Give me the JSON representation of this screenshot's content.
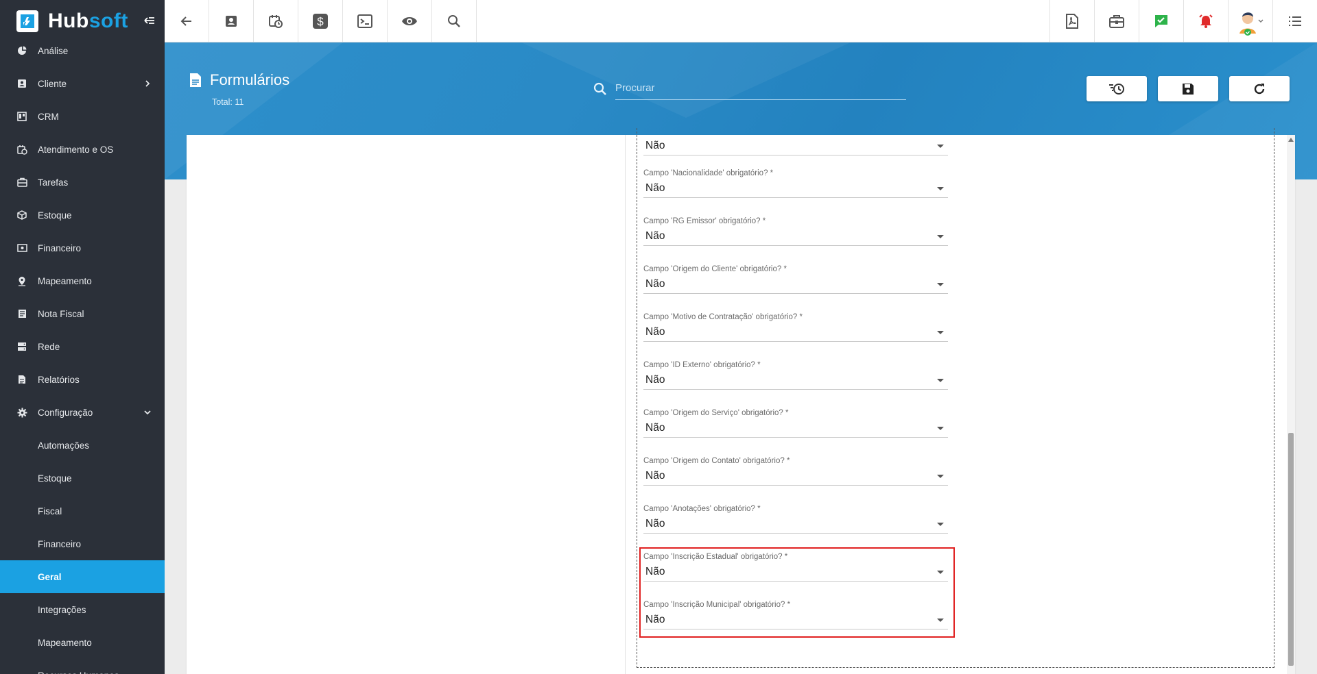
{
  "app": {
    "logo_part1": "Hub",
    "logo_part2": "soft"
  },
  "sidebar": {
    "items": [
      {
        "label": "Análise",
        "icon": "pie-chart-icon"
      },
      {
        "label": "Cliente",
        "icon": "contact-card-icon",
        "has_children": true
      },
      {
        "label": "CRM",
        "icon": "kanban-icon"
      },
      {
        "label": "Atendimento e OS",
        "icon": "calendar-clock-icon"
      },
      {
        "label": "Tarefas",
        "icon": "briefcase-icon"
      },
      {
        "label": "Estoque",
        "icon": "box-icon"
      },
      {
        "label": "Financeiro",
        "icon": "money-icon"
      },
      {
        "label": "Mapeamento",
        "icon": "map-pin-icon"
      },
      {
        "label": "Nota Fiscal",
        "icon": "invoice-icon"
      },
      {
        "label": "Rede",
        "icon": "server-icon"
      },
      {
        "label": "Relatórios",
        "icon": "report-icon"
      },
      {
        "label": "Configuração",
        "icon": "gear-icon",
        "expanded": true
      }
    ],
    "subitems": [
      {
        "label": "Automações"
      },
      {
        "label": "Estoque"
      },
      {
        "label": "Fiscal"
      },
      {
        "label": "Financeiro"
      },
      {
        "label": "Geral",
        "active": true
      },
      {
        "label": "Integrações"
      },
      {
        "label": "Mapeamento"
      },
      {
        "label": "Recursos Humanos"
      }
    ]
  },
  "topbar": {
    "left_buttons": [
      "back-arrow-icon",
      "contact-card-icon",
      "calendar-clock-icon",
      "dollar-icon",
      "terminal-icon",
      "eye-icon",
      "search-icon"
    ],
    "right_buttons": [
      "pdf-icon",
      "briefcase-icon",
      "chat-check-icon",
      "alarm-bell-icon",
      "avatar",
      "list-menu-icon"
    ]
  },
  "header": {
    "title": "Formulários",
    "subtitle": "Total: 11",
    "search_placeholder": "Procurar",
    "buttons": [
      "history-icon",
      "save-icon",
      "refresh-icon"
    ]
  },
  "form": {
    "fields": [
      {
        "label": "",
        "value": "Não"
      },
      {
        "label": "Campo 'Nacionalidade' obrigatório? *",
        "value": "Não"
      },
      {
        "label": "Campo 'RG Emissor' obrigatório? *",
        "value": "Não"
      },
      {
        "label": "Campo 'Origem do Cliente' obrigatório? *",
        "value": "Não"
      },
      {
        "label": "Campo 'Motivo de Contratação' obrigatório? *",
        "value": "Não"
      },
      {
        "label": "Campo 'ID Externo' obrigatório? *",
        "value": "Não"
      },
      {
        "label": "Campo 'Origem do Serviço' obrigatório? *",
        "value": "Não"
      },
      {
        "label": "Campo 'Origem do Contato' obrigatório? *",
        "value": "Não"
      },
      {
        "label": "Campo 'Anotações' obrigatório? *",
        "value": "Não"
      },
      {
        "label": "Campo 'Inscrição Estadual' obrigatório? *",
        "value": "Não"
      },
      {
        "label": "Campo 'Inscrição Municipal' obrigatório? *",
        "value": "Não"
      }
    ]
  },
  "colors": {
    "accent": "#1ba1e2",
    "sidebar_bg": "#2b3039",
    "highlight": "#e02020"
  }
}
